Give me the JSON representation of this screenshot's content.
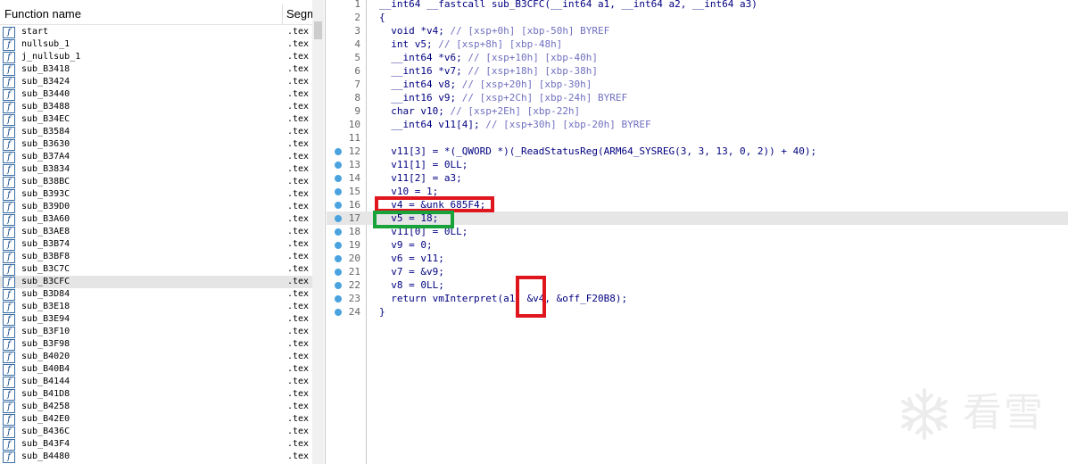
{
  "functions_panel": {
    "header_name": "Function name",
    "header_segment": "Segm",
    "rows": [
      {
        "name": "start",
        "seg": ".tex"
      },
      {
        "name": "nullsub_1",
        "seg": ".tex"
      },
      {
        "name": "j_nullsub_1",
        "seg": ".tex"
      },
      {
        "name": "sub_B3418",
        "seg": ".tex"
      },
      {
        "name": "sub_B3424",
        "seg": ".tex"
      },
      {
        "name": "sub_B3440",
        "seg": ".tex"
      },
      {
        "name": "sub_B3488",
        "seg": ".tex"
      },
      {
        "name": "sub_B34EC",
        "seg": ".tex"
      },
      {
        "name": "sub_B3584",
        "seg": ".tex"
      },
      {
        "name": "sub_B3630",
        "seg": ".tex"
      },
      {
        "name": "sub_B37A4",
        "seg": ".tex"
      },
      {
        "name": "sub_B3834",
        "seg": ".tex"
      },
      {
        "name": "sub_B38BC",
        "seg": ".tex"
      },
      {
        "name": "sub_B393C",
        "seg": ".tex"
      },
      {
        "name": "sub_B39D0",
        "seg": ".tex"
      },
      {
        "name": "sub_B3A60",
        "seg": ".tex"
      },
      {
        "name": "sub_B3AE8",
        "seg": ".tex"
      },
      {
        "name": "sub_B3B74",
        "seg": ".tex"
      },
      {
        "name": "sub_B3BF8",
        "seg": ".tex"
      },
      {
        "name": "sub_B3C7C",
        "seg": ".tex"
      },
      {
        "name": "sub_B3CFC",
        "seg": ".tex",
        "selected": true
      },
      {
        "name": "sub_B3D84",
        "seg": ".tex"
      },
      {
        "name": "sub_B3E18",
        "seg": ".tex"
      },
      {
        "name": "sub_B3E94",
        "seg": ".tex"
      },
      {
        "name": "sub_B3F10",
        "seg": ".tex"
      },
      {
        "name": "sub_B3F98",
        "seg": ".tex"
      },
      {
        "name": "sub_B4020",
        "seg": ".tex"
      },
      {
        "name": "sub_B40B4",
        "seg": ".tex"
      },
      {
        "name": "sub_B4144",
        "seg": ".tex"
      },
      {
        "name": "sub_B41D8",
        "seg": ".tex"
      },
      {
        "name": "sub_B4258",
        "seg": ".tex"
      },
      {
        "name": "sub_B42E0",
        "seg": ".tex"
      },
      {
        "name": "sub_B436C",
        "seg": ".tex"
      },
      {
        "name": "sub_B43F4",
        "seg": ".tex"
      },
      {
        "name": "sub_B4480",
        "seg": ".tex"
      }
    ],
    "function_icon": "function-icon"
  },
  "code_panel": {
    "lines": [
      {
        "n": "1",
        "text": "__int64 __fastcall sub_B3CFC(__int64 a1, __int64 a2, __int64 a3)",
        "bp": false
      },
      {
        "n": "2",
        "text": "{",
        "bp": false
      },
      {
        "n": "3",
        "text": "  void *v4; // [xsp+0h] [xbp-50h] BYREF",
        "bp": false
      },
      {
        "n": "4",
        "text": "  int v5; // [xsp+8h] [xbp-48h]",
        "bp": false
      },
      {
        "n": "5",
        "text": "  __int64 *v6; // [xsp+10h] [xbp-40h]",
        "bp": false
      },
      {
        "n": "6",
        "text": "  __int16 *v7; // [xsp+18h] [xbp-38h]",
        "bp": false
      },
      {
        "n": "7",
        "text": "  __int64 v8; // [xsp+20h] [xbp-30h]",
        "bp": false
      },
      {
        "n": "8",
        "text": "  __int16 v9; // [xsp+2Ch] [xbp-24h] BYREF",
        "bp": false
      },
      {
        "n": "9",
        "text": "  char v10; // [xsp+2Eh] [xbp-22h]",
        "bp": false
      },
      {
        "n": "10",
        "text": "  __int64 v11[4]; // [xsp+30h] [xbp-20h] BYREF",
        "bp": false
      },
      {
        "n": "11",
        "text": "",
        "bp": false
      },
      {
        "n": "12",
        "text": "  v11[3] = *(_QWORD *)(_ReadStatusReg(ARM64_SYSREG(3, 3, 13, 0, 2)) + 40);",
        "bp": true
      },
      {
        "n": "13",
        "text": "  v11[1] = 0LL;",
        "bp": true
      },
      {
        "n": "14",
        "text": "  v11[2] = a3;",
        "bp": true
      },
      {
        "n": "15",
        "text": "  v10 = 1;",
        "bp": true
      },
      {
        "n": "16",
        "text": "  v4 = &unk_685F4;",
        "bp": true
      },
      {
        "n": "17",
        "text": "  v5 = 18;",
        "bp": true,
        "highlight": true
      },
      {
        "n": "18",
        "text": "  v11[0] = 0LL;",
        "bp": true
      },
      {
        "n": "19",
        "text": "  v9 = 0;",
        "bp": true
      },
      {
        "n": "20",
        "text": "  v6 = v11;",
        "bp": true
      },
      {
        "n": "21",
        "text": "  v7 = &v9;",
        "bp": true
      },
      {
        "n": "22",
        "text": "  v8 = 0LL;",
        "bp": true
      },
      {
        "n": "23",
        "text": "  return vmInterpret(a1, &v4, &off_F20B8);",
        "bp": true
      },
      {
        "n": "24",
        "text": "}",
        "bp": true
      }
    ],
    "breakpoint_color": "#4aa3df",
    "comment_color": "#7070c0",
    "text_color": "#000080"
  },
  "annotations": {
    "red": "#e0161e",
    "green": "#18a23a"
  },
  "watermark": {
    "text": "看雪",
    "icon": "snowflake-icon"
  }
}
